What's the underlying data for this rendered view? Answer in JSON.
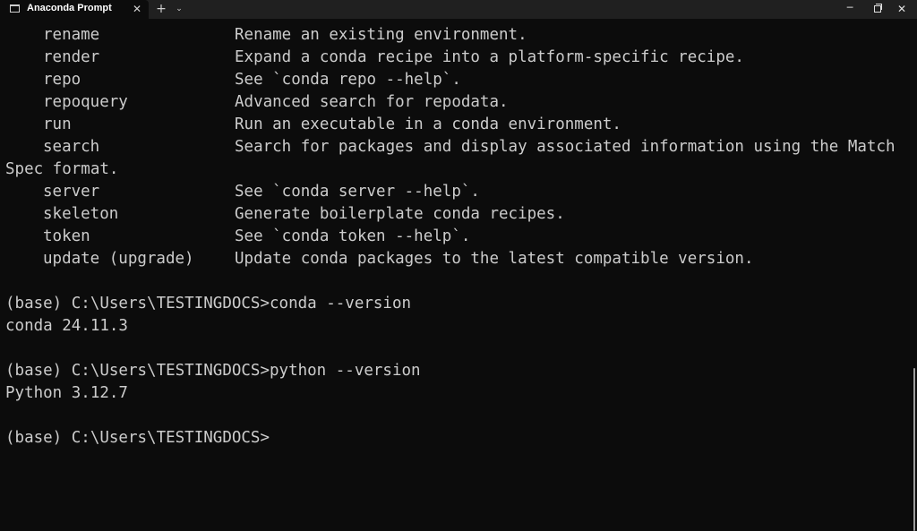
{
  "window": {
    "tab_title": "Anaconda Prompt",
    "tab_close": "✕",
    "new_tab": "+",
    "tab_dropdown": "⌄",
    "minimize": "─",
    "close": "✕"
  },
  "terminal": {
    "commands": [
      {
        "name": "rename",
        "desc": "Rename an existing environment."
      },
      {
        "name": "render",
        "desc": "Expand a conda recipe into a platform-specific recipe."
      },
      {
        "name": "repo",
        "desc": "See `conda repo --help`."
      },
      {
        "name": "repoquery",
        "desc": "Advanced search for repodata."
      },
      {
        "name": "run",
        "desc": "Run an executable in a conda environment."
      },
      {
        "name": "search",
        "desc": "Search for packages and display associated information using the Match"
      }
    ],
    "wrap_line": "Spec format.",
    "commands_2": [
      {
        "name": "server",
        "desc": "See `conda server --help`."
      },
      {
        "name": "skeleton",
        "desc": "Generate boilerplate conda recipes."
      },
      {
        "name": "token",
        "desc": "See `conda token --help`."
      },
      {
        "name": "update (upgrade)",
        "desc": "Update conda packages to the latest compatible version."
      }
    ],
    "prompt_1": "(base) C:\\Users\\TESTINGDOCS>conda --version",
    "output_1": "conda 24.11.3",
    "prompt_2": "(base) C:\\Users\\TESTINGDOCS>python --version",
    "output_2": "Python 3.12.7",
    "prompt_3": "(base) C:\\Users\\TESTINGDOCS>"
  }
}
